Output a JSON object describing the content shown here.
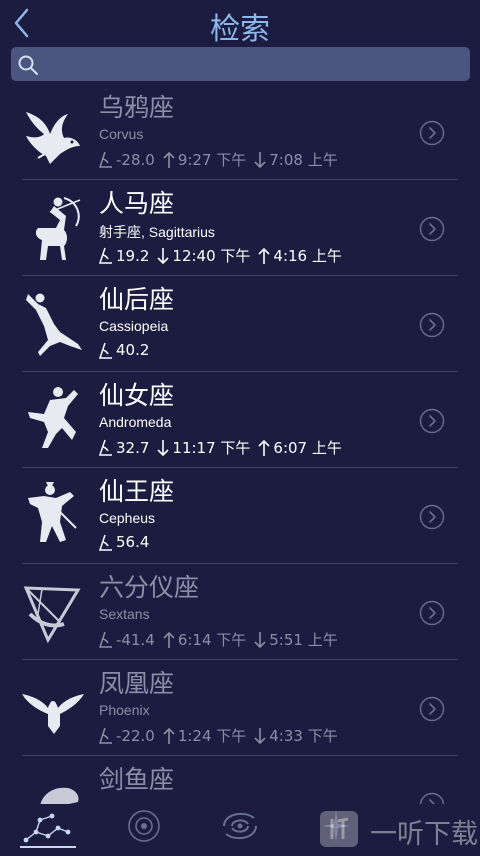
{
  "header": {
    "title": "检索",
    "back_icon": "chevron-left-icon"
  },
  "search": {
    "value": "",
    "placeholder": "",
    "icon": "search-icon"
  },
  "rows": [
    {
      "name": "乌鸦座",
      "latin": "Corvus",
      "alt": "-28.0",
      "rise": "9:27 下午",
      "set": "7:08 上午",
      "dim": true,
      "icon": "crow-icon"
    },
    {
      "name": "人马座",
      "latin": "射手座, Sagittarius",
      "alt": "19.2",
      "set": "12:40 下午",
      "rise": "4:16 上午",
      "dim": false,
      "icon": "centaur-archer-icon"
    },
    {
      "name": "仙后座",
      "latin": "Cassiopeia",
      "alt": "40.2",
      "dim": false,
      "icon": "queen-figure-icon"
    },
    {
      "name": "仙女座",
      "latin": "Andromeda",
      "alt": "32.7",
      "set": "11:17 下午",
      "rise": "6:07 上午",
      "dim": false,
      "icon": "maiden-figure-icon"
    },
    {
      "name": "仙王座",
      "latin": "Cepheus",
      "alt": "56.4",
      "dim": false,
      "icon": "king-figure-icon"
    },
    {
      "name": "六分仪座",
      "latin": "Sextans",
      "alt": "-41.4",
      "rise": "6:14 下午",
      "set": "5:51 上午",
      "dim": true,
      "icon": "sextant-icon"
    },
    {
      "name": "凤凰座",
      "latin": "Phoenix",
      "alt": "-22.0",
      "rise": "1:24 下午",
      "set": "4:33 下午",
      "dim": true,
      "icon": "phoenix-icon"
    },
    {
      "name": "剑鱼座",
      "dim": true,
      "icon": "swordfish-icon"
    }
  ],
  "tabs": [
    "constellations-tab-icon",
    "solar-system-tab-icon",
    "galaxy-tab-icon",
    "stars-tab-icon"
  ],
  "watermark": {
    "text": "一听下载"
  }
}
